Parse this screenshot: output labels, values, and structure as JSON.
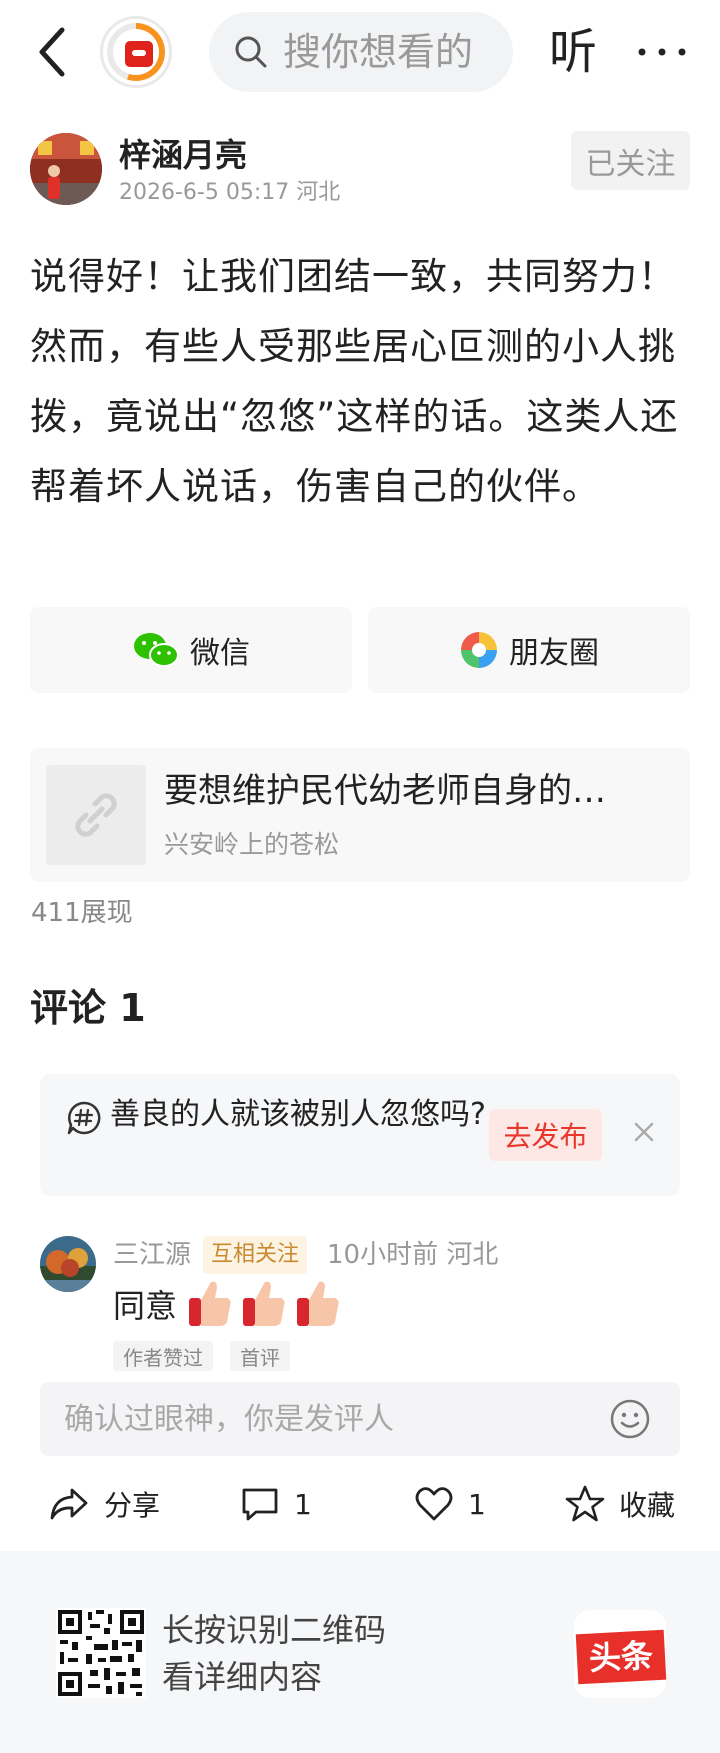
{
  "topbar": {
    "search_placeholder": "搜你想看的",
    "listen_label": "听"
  },
  "author": {
    "name": "梓涵月亮",
    "meta": "2026-6-5 05:17  河北",
    "follow_label": "已关注"
  },
  "post": {
    "text": "说得好！让我们团结一致，共同努力！然而，有些人受那些居心叵测的小人挑拨，竟说出“忽悠”这样的话。这类人还帮着坏人说话，伤害自己的伙伴。"
  },
  "share": {
    "wechat_label": "微信",
    "moments_label": "朋友圈"
  },
  "link_card": {
    "title": "要想维护民代幼老师自身的…",
    "author": "兴安岭上的苍松"
  },
  "views": "411展现",
  "comments": {
    "title": "评论 1",
    "topic": {
      "text": "善良的人就该被别人忽悠吗?",
      "publish_label": "去发布"
    },
    "items": [
      {
        "name": "三江源",
        "badge": "互相关注",
        "time": "10小时前  河北",
        "text": "同意",
        "tags": [
          "作者赞过",
          "首评"
        ]
      }
    ],
    "input_placeholder": "确认过眼神，你是发评人"
  },
  "actions": {
    "share_label": "分享",
    "comment_count": "1",
    "like_count": "1",
    "favorite_label": "收藏"
  },
  "footer": {
    "line1": "长按识别二维码",
    "line2": "看详细内容",
    "brand": "头条"
  },
  "colors": {
    "accent_red": "#e8372b",
    "muted_text": "#999999",
    "wechat_green": "#2dc100",
    "badge_gold": "#c98a2f"
  }
}
